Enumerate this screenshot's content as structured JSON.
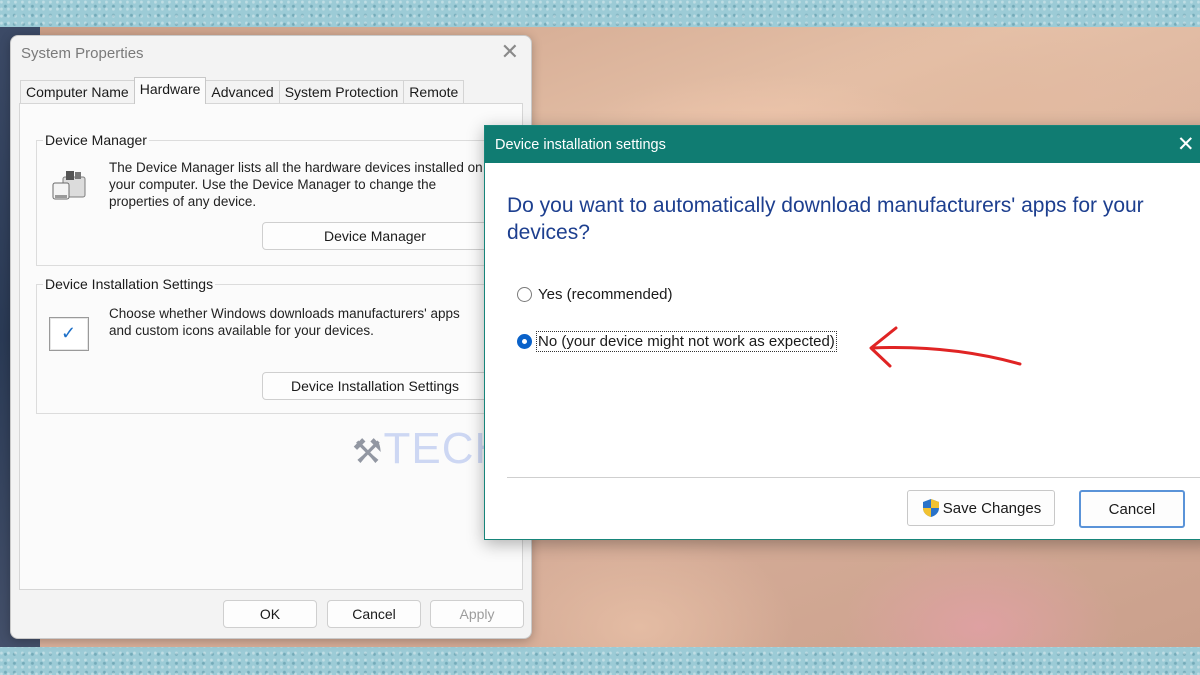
{
  "system_properties": {
    "title": "System Properties",
    "tabs": [
      "Computer Name",
      "Hardware",
      "Advanced",
      "System Protection",
      "Remote"
    ],
    "active_tab": "Hardware",
    "device_manager": {
      "group_label": "Device Manager",
      "description": "The Device Manager lists all the hardware devices installed on your computer. Use the Device Manager to change the properties of any device.",
      "button": "Device Manager"
    },
    "device_installation": {
      "group_label": "Device Installation Settings",
      "description": "Choose whether Windows downloads manufacturers' apps and custom icons available for your devices.",
      "button": "Device Installation Settings"
    },
    "footer": {
      "ok": "OK",
      "cancel": "Cancel",
      "apply": "Apply"
    }
  },
  "watermark": {
    "text": "TECHNOYL"
  },
  "dialog": {
    "title": "Device installation settings",
    "question": "Do you want to automatically download manufacturers' apps for your devices?",
    "options": [
      {
        "label": "Yes (recommended)",
        "selected": false
      },
      {
        "label": "No (your device might not work as expected)",
        "selected": true
      }
    ],
    "save_button": "Save Changes",
    "cancel_button": "Cancel",
    "accent_color": "#107c72",
    "annotation_arrow_color": "#e02424"
  }
}
